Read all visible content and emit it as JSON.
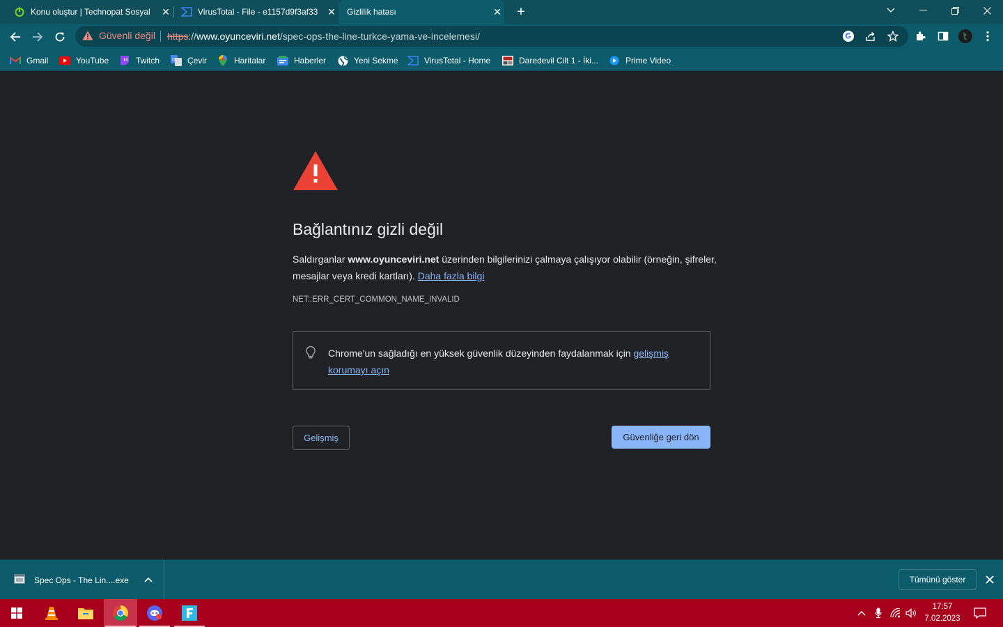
{
  "tabs": [
    {
      "title": "Konu oluştur | Technopat Sosyal",
      "icon": "power-icon"
    },
    {
      "title": "VirusTotal - File - e1157d9f3af33",
      "icon": "virustotal-icon"
    },
    {
      "title": "Gizlilik hatası",
      "icon": "none",
      "active": true
    }
  ],
  "omnibox": {
    "security_label": "Güvenli değil",
    "scheme": "https",
    "separator": "://",
    "host": "www.oyunceviri.net",
    "path": "/spec-ops-the-line-turkce-yama-ve-incelemesi/"
  },
  "bookmarks": [
    {
      "label": "Gmail",
      "icon": "gmail-icon"
    },
    {
      "label": "YouTube",
      "icon": "youtube-icon"
    },
    {
      "label": "Twitch",
      "icon": "twitch-icon"
    },
    {
      "label": "Çevir",
      "icon": "translate-icon"
    },
    {
      "label": "Haritalar",
      "icon": "maps-icon"
    },
    {
      "label": "Haberler",
      "icon": "news-icon"
    },
    {
      "label": "Yeni Sekme",
      "icon": "globe-icon"
    },
    {
      "label": "VirusTotal - Home",
      "icon": "virustotal-icon"
    },
    {
      "label": "Daredevil Cilt 1 - İki...",
      "icon": "comic-icon"
    },
    {
      "label": "Prime Video",
      "icon": "prime-video-icon"
    }
  ],
  "error_page": {
    "heading": "Bağlantınız gizli değil",
    "desc_prefix": "Saldırganlar ",
    "desc_host": "www.oyunceviri.net",
    "desc_suffix": " üzerinden bilgilerinizi çalmaya çalışıyor olabilir (örneğin, şifreler, mesajlar veya kredi kartları). ",
    "learn_more": "Daha fazla bilgi",
    "error_code": "NET::ERR_CERT_COMMON_NAME_INVALID",
    "enhanced_text": "Chrome'un sağladığı en yüksek güvenlik düzeyinden faydalanmak için ",
    "enhanced_link": "gelişmiş korumayı açın",
    "advanced_button": "Gelişmiş",
    "back_button": "Güvenliğe geri dön"
  },
  "download_shelf": {
    "file_name": "Spec Ops - The Lin....exe",
    "show_all": "Tümünü göster"
  },
  "taskbar": {
    "apps": [
      "start-icon",
      "vlc-icon",
      "file-explorer-icon",
      "chrome-icon",
      "discord-icon",
      "f-app-icon"
    ],
    "time": "17:57",
    "date": "7.02.2023"
  },
  "colors": {
    "tab_bar": "#0e4d5a",
    "toolbar": "#0c5b6b",
    "page_bg": "#202124",
    "link": "#8ab4f8",
    "warning_red": "#ea4335",
    "taskbar": "#a8001c"
  }
}
